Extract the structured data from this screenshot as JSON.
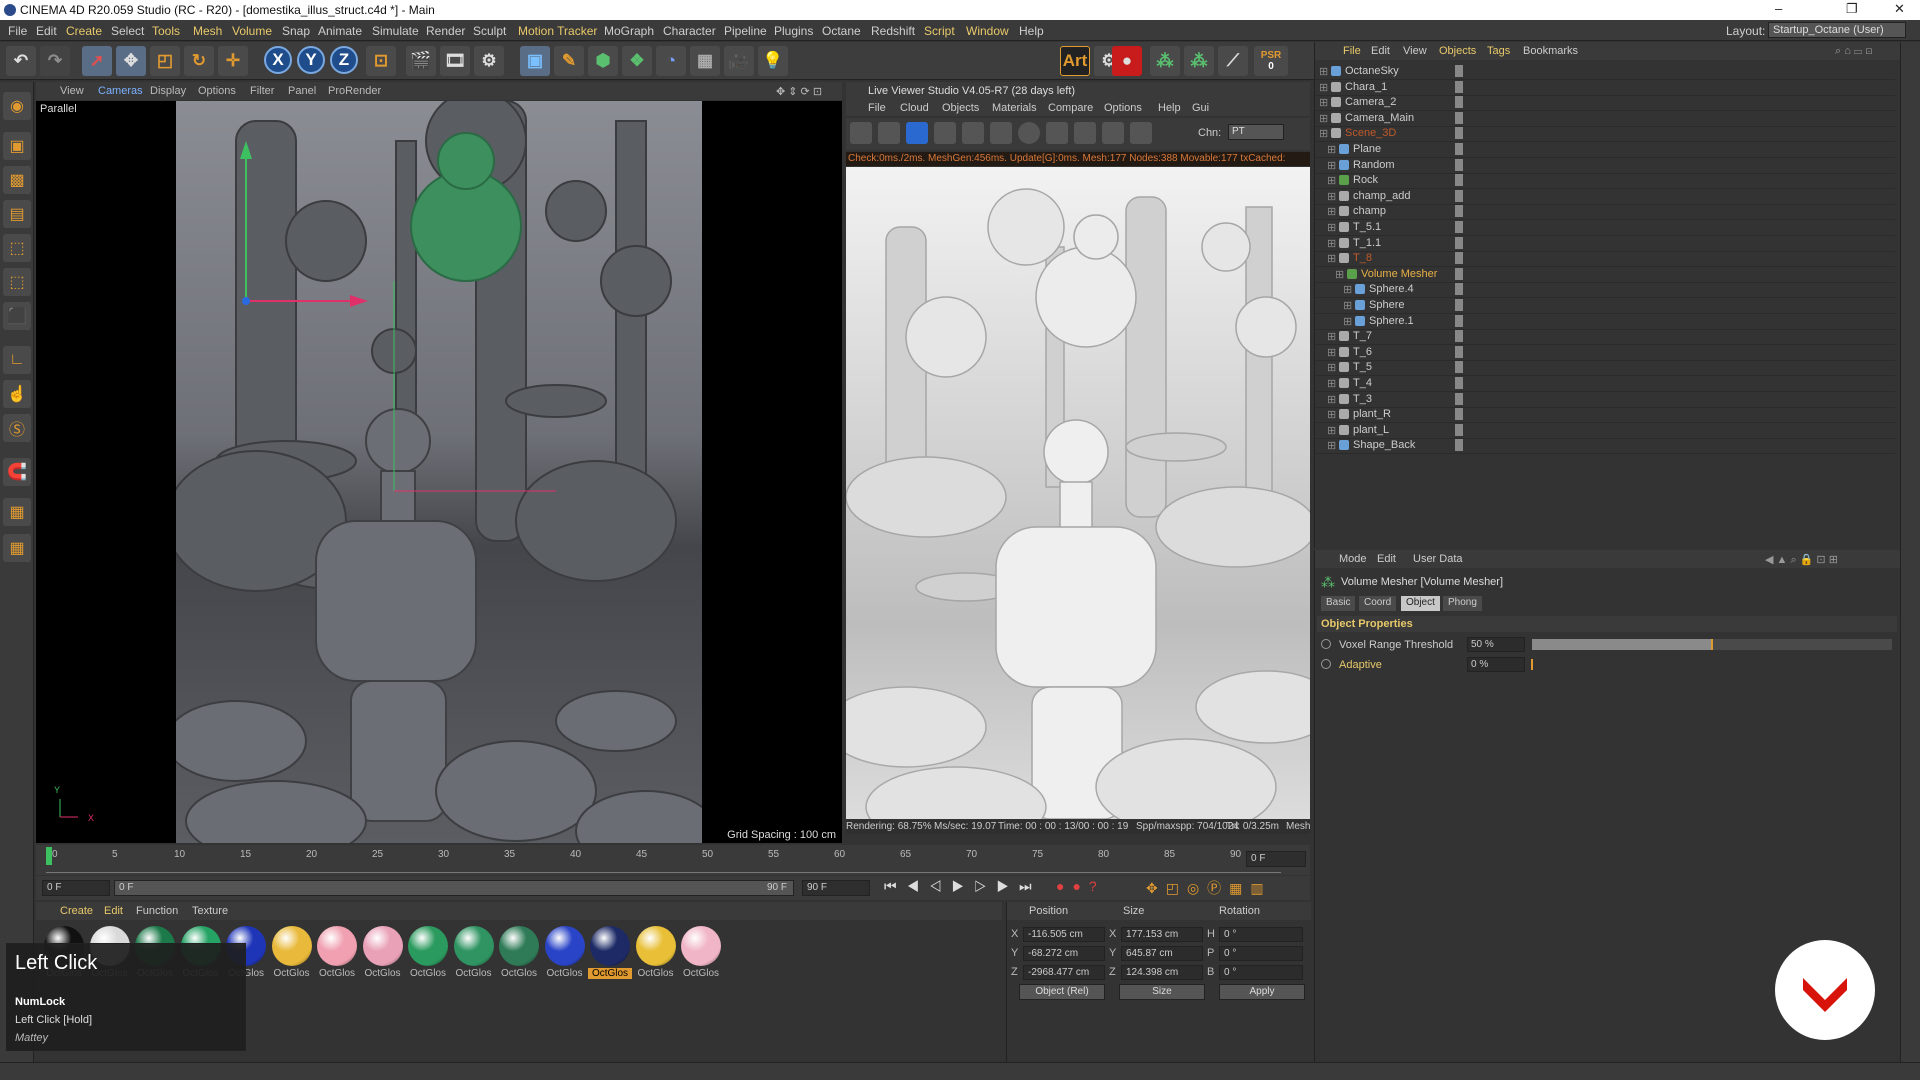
{
  "window": {
    "title": "CINEMA 4D R20.059 Studio (RC - R20) - [domestika_illus_struct.c4d *] - Main",
    "controls": [
      "–",
      "❐",
      "✕"
    ]
  },
  "menubar": {
    "items": [
      "File",
      "Edit",
      "Create",
      "Select",
      "Tools",
      "Mesh",
      "Volume",
      "Snap",
      "Animate",
      "Simulate",
      "Render",
      "Sculpt",
      "Motion Tracker",
      "MoGraph",
      "Character",
      "Pipeline",
      "Plugins",
      "Octane",
      "Redshift",
      "Script",
      "Window",
      "Help"
    ],
    "layout_label": "Layout:",
    "layout_value": "Startup_Octane (User)"
  },
  "toolbar": {
    "psr_label": "PSR",
    "psr_value": "0",
    "art_label": "Art"
  },
  "viewport": {
    "menu": [
      "View",
      "Cameras",
      "Display",
      "Options",
      "Filter",
      "Panel",
      "ProRender"
    ],
    "projection": "Parallel",
    "grid_spacing": "Grid Spacing : 100 cm",
    "axis_y": "Y",
    "axis_x": "X"
  },
  "live_viewer": {
    "title": "Live Viewer Studio V4.05-R7 (28 days left)",
    "menu": [
      "File",
      "Cloud",
      "Objects",
      "Materials",
      "Compare",
      "Options",
      "Help",
      "Gui"
    ],
    "channel_label": "Chn:",
    "channel_value": "PT",
    "status": "Check:0ms./2ms. MeshGen:456ms. Update[G]:0ms. Mesh:177 Nodes:388 Movable:177 txCached:",
    "bottom": {
      "rendering": "Rendering: 68.75%",
      "ms_sec": "Ms/sec: 19.07",
      "time": "Time: 00 : 00 : 13/00 : 00 : 19",
      "spp": "Spp/maxspp: 704/1024",
      "tri": "Tri: 0/3.25m",
      "mesh": "Mesh"
    }
  },
  "timeline": {
    "ticks": [
      "0",
      "5",
      "10",
      "15",
      "20",
      "25",
      "30",
      "35",
      "40",
      "45",
      "50",
      "55",
      "60",
      "65",
      "70",
      "75",
      "80",
      "85",
      "90"
    ],
    "end_field": "0 F",
    "start_field": "0 F",
    "range_start": "0 F",
    "range_end": "90 F",
    "max_field": "90 F"
  },
  "materials": {
    "menu": [
      "Create",
      "Edit",
      "Function",
      "Texture"
    ],
    "items": [
      {
        "label": "OctGlos",
        "color": "#111111"
      },
      {
        "label": "OctGlos",
        "color": "#d9d9d9"
      },
      {
        "label": "OctGlos",
        "color": "#1c7a4a"
      },
      {
        "label": "OctGlos",
        "color": "#25a365"
      },
      {
        "label": "OctGlos",
        "color": "#1f35b8"
      },
      {
        "label": "OctGlos",
        "color": "#e8b93a"
      },
      {
        "label": "OctGlos",
        "color": "#f0a0b0"
      },
      {
        "label": "OctGlos",
        "color": "#e9a1b8"
      },
      {
        "label": "OctGlos",
        "color": "#2b9a5e"
      },
      {
        "label": "OctGlos",
        "color": "#2f9462"
      },
      {
        "label": "OctGlos",
        "color": "#2f7b57"
      },
      {
        "label": "OctGlos",
        "color": "#2a44c8"
      },
      {
        "label": "OctGlos",
        "color": "#1d2a66"
      },
      {
        "label": "OctGlos",
        "color": "#e8bf36"
      },
      {
        "label": "OctGlos",
        "color": "#f0b5c6"
      }
    ],
    "selected_index": 12
  },
  "coords": {
    "headers": [
      "Position",
      "Size",
      "Rotation"
    ],
    "rows": [
      {
        "axis": "X",
        "pos": "-116.505 cm",
        "saxis": "X",
        "size": "177.153 cm",
        "raxis": "H",
        "rot": "0 °"
      },
      {
        "axis": "Y",
        "pos": "-68.272 cm",
        "saxis": "Y",
        "size": "645.87 cm",
        "raxis": "P",
        "rot": "0 °"
      },
      {
        "axis": "Z",
        "pos": "-2968.477 cm",
        "saxis": "Z",
        "size": "124.398 cm",
        "raxis": "B",
        "rot": "0 °"
      }
    ],
    "mode_select": "Object (Rel)",
    "size_select": "Size",
    "apply": "Apply"
  },
  "objects": {
    "menu": [
      "File",
      "Edit",
      "View",
      "Objects",
      "Tags",
      "Bookmarks"
    ],
    "rows": [
      {
        "name": "OctaneSky",
        "indent": 0,
        "style": "",
        "icon": "#6aa0d8"
      },
      {
        "name": "Chara_1",
        "indent": 0,
        "style": "",
        "icon": "#aaa"
      },
      {
        "name": "Camera_2",
        "indent": 0,
        "style": "",
        "icon": "#aaa"
      },
      {
        "name": "Camera_Main",
        "indent": 0,
        "style": "",
        "icon": "#aaa"
      },
      {
        "name": "Scene_3D",
        "indent": 0,
        "style": "dim",
        "icon": "#aaa"
      },
      {
        "name": "Plane",
        "indent": 1,
        "style": "",
        "icon": "#6aa0d8"
      },
      {
        "name": "Random",
        "indent": 1,
        "style": "",
        "icon": "#6aa0d8"
      },
      {
        "name": "Rock",
        "indent": 1,
        "style": "",
        "icon": "#5aa04a"
      },
      {
        "name": "champ_add",
        "indent": 1,
        "style": "",
        "icon": "#aaa"
      },
      {
        "name": "champ",
        "indent": 1,
        "style": "",
        "icon": "#aaa"
      },
      {
        "name": "T_5.1",
        "indent": 1,
        "style": "",
        "icon": "#aaa"
      },
      {
        "name": "T_1.1",
        "indent": 1,
        "style": "",
        "icon": "#aaa"
      },
      {
        "name": "T_8",
        "indent": 1,
        "style": "dim",
        "icon": "#aaa"
      },
      {
        "name": "Volume Mesher",
        "indent": 2,
        "style": "sel",
        "icon": "#5aa04a"
      },
      {
        "name": "Sphere.4",
        "indent": 3,
        "style": "",
        "icon": "#6aa0d8"
      },
      {
        "name": "Sphere",
        "indent": 3,
        "style": "",
        "icon": "#6aa0d8"
      },
      {
        "name": "Sphere.1",
        "indent": 3,
        "style": "",
        "icon": "#6aa0d8"
      },
      {
        "name": "T_7",
        "indent": 1,
        "style": "",
        "icon": "#aaa"
      },
      {
        "name": "T_6",
        "indent": 1,
        "style": "",
        "icon": "#aaa"
      },
      {
        "name": "T_5",
        "indent": 1,
        "style": "",
        "icon": "#aaa"
      },
      {
        "name": "T_4",
        "indent": 1,
        "style": "",
        "icon": "#aaa"
      },
      {
        "name": "T_3",
        "indent": 1,
        "style": "",
        "icon": "#aaa"
      },
      {
        "name": "plant_R",
        "indent": 1,
        "style": "",
        "icon": "#aaa"
      },
      {
        "name": "plant_L",
        "indent": 1,
        "style": "",
        "icon": "#aaa"
      },
      {
        "name": "Shape_Back",
        "indent": 1,
        "style": "",
        "icon": "#6aa0d8"
      }
    ]
  },
  "attributes": {
    "menu": [
      "Mode",
      "Edit",
      "User Data"
    ],
    "title": "Volume Mesher [Volume Mesher]",
    "tabs": [
      "Basic",
      "Coord",
      "Object",
      "Phong"
    ],
    "active_tab": "Object",
    "section": "Object Properties",
    "props": [
      {
        "label": "Voxel Range Threshold",
        "value": "50 %",
        "fraction": 0.5
      },
      {
        "label": "Adaptive",
        "value": "0 %",
        "fraction": 0.0
      }
    ]
  },
  "tooltip": {
    "title": "Left Click",
    "key": "NumLock",
    "sub": "Left Click [Hold]",
    "user": "Mattey"
  },
  "colors": {
    "accent": "#e09a30",
    "selected_object": "#e8b046",
    "status_text": "#d9793a",
    "badge_red": "#d8140a"
  }
}
